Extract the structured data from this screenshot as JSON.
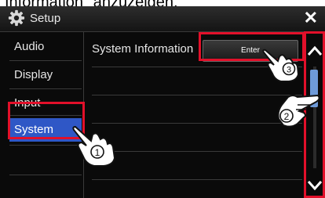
{
  "caption": "Information\" anzuzeigen.",
  "header": {
    "title": "Setup",
    "close_label": "✕",
    "icon": "gear-icon"
  },
  "sidebar": {
    "items": [
      {
        "label": "Audio"
      },
      {
        "label": "Display"
      },
      {
        "label": "Input"
      },
      {
        "label": "System",
        "selected": true
      }
    ]
  },
  "main": {
    "row_label": "System Information",
    "enter_label": "Enter"
  },
  "scrollbar": {
    "up_icon": "chevron-up-icon",
    "down_icon": "chevron-down-icon",
    "position_fraction": 0.1
  },
  "callouts": {
    "step1": "1",
    "step2": "2",
    "step3": "3",
    "highlight_color": "#e2102a"
  },
  "colors": {
    "accent": "#2f57c6",
    "scroll_thumb": "#6e9ad8"
  }
}
